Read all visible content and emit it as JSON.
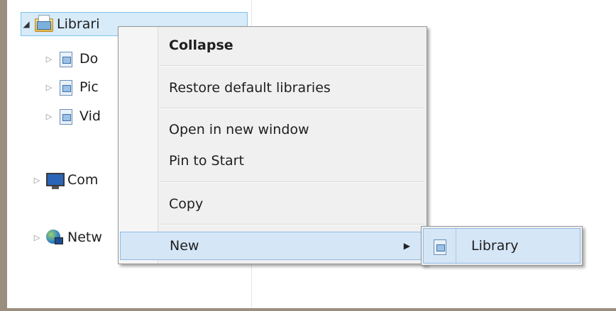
{
  "nav_pane": {
    "libraries_label": "Librari",
    "documents_label": "Do",
    "pictures_label": "Pic",
    "videos_label": "Vid",
    "computer_label": "Com",
    "network_label": "Netw"
  },
  "context_menu": {
    "collapse": "Collapse",
    "restore_default_libraries": "Restore default libraries",
    "open_in_new_window": "Open in new window",
    "pin_to_start": "Pin to Start",
    "copy": "Copy",
    "new": "New",
    "submenu_arrow": "▶"
  },
  "submenu": {
    "library": "Library"
  },
  "icons": {
    "expand_open": "◢",
    "expand_closed": "▷"
  },
  "colors": {
    "selection_fill": "#d5e6f7",
    "selection_border": "#8fbbe6",
    "menu_background": "#f0f0f0"
  }
}
